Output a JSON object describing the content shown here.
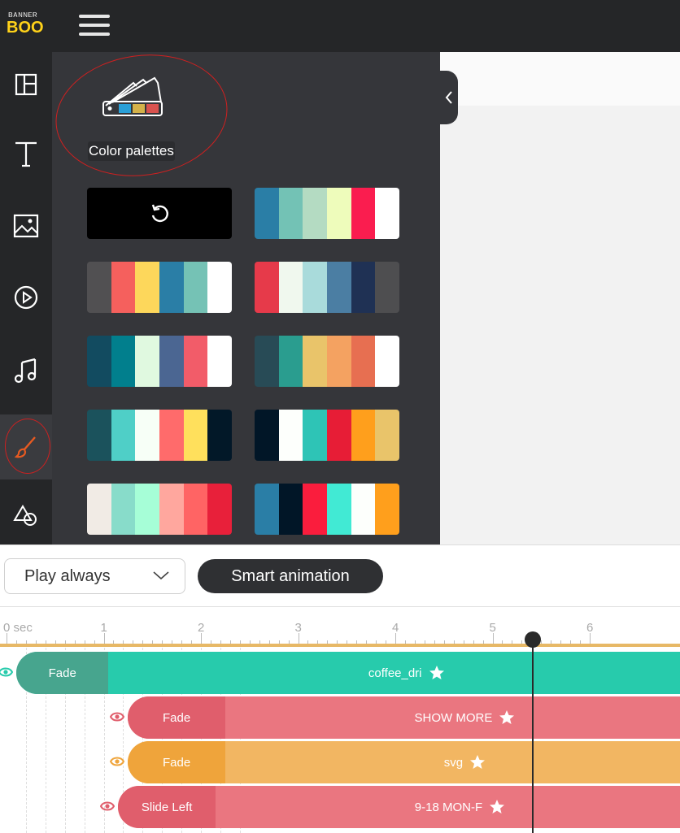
{
  "app": {
    "logo_top": "BANNER",
    "logo_bottom": "BOO"
  },
  "sidebar": {
    "items": [
      {
        "id": "layout",
        "icon": "layout-icon"
      },
      {
        "id": "text",
        "icon": "text-icon"
      },
      {
        "id": "image",
        "icon": "image-icon"
      },
      {
        "id": "video",
        "icon": "play-circle-icon"
      },
      {
        "id": "audio",
        "icon": "music-icon"
      },
      {
        "id": "colors",
        "icon": "brush-icon",
        "active": true
      },
      {
        "id": "shapes",
        "icon": "shapes-icon"
      }
    ]
  },
  "panel": {
    "title": "Color palettes",
    "palettes": [
      {
        "reset": true,
        "colors": []
      },
      {
        "colors": [
          "#2a7ea6",
          "#73c2b5",
          "#b4dbc2",
          "#eefcbb",
          "#fa1d4f",
          "#ffffff"
        ]
      },
      {
        "colors": [
          "#515052",
          "#f5605d",
          "#fdd75b",
          "#2a7ea6",
          "#75c2b5",
          "#ffffff"
        ]
      },
      {
        "colors": [
          "#e63a4a",
          "#f0f8ee",
          "#a9dbdb",
          "#4b7ea3",
          "#1f3154",
          "#4e4e50"
        ]
      },
      {
        "colors": [
          "#124b60",
          "#017f8d",
          "#e0f9e0",
          "#4b6692",
          "#f25c69",
          "#ffffff"
        ]
      },
      {
        "colors": [
          "#284b56",
          "#2a9d8f",
          "#e9c46a",
          "#f4a261",
          "#e76f51",
          "#ffffff"
        ]
      },
      {
        "colors": [
          "#1b525c",
          "#4fcfc7",
          "#f7fff7",
          "#ff6b6b",
          "#ffe05c",
          "#021828"
        ]
      },
      {
        "colors": [
          "#011627",
          "#fdfffc",
          "#2ec4b6",
          "#e71d36",
          "#ff9f1c",
          "#e9c46a"
        ]
      },
      {
        "colors": [
          "#f1ebe5",
          "#88dcca",
          "#a6fed7",
          "#ffa79e",
          "#ff6464",
          "#e8203a"
        ]
      },
      {
        "colors": [
          "#2a7ea6",
          "#011627",
          "#fa1d3d",
          "#41ead4",
          "#fdfffc",
          "#ff9f1c"
        ]
      }
    ]
  },
  "controls": {
    "play_mode": "Play always",
    "smart_animation": "Smart animation"
  },
  "timeline": {
    "ticks": [
      "0 sec",
      "1",
      "2",
      "3",
      "4",
      "5",
      "6"
    ],
    "playhead_sec": 5.42,
    "tracks": [
      {
        "animation": "Fade",
        "name": "coffee_dri",
        "start_sec": 0.1,
        "anim_end_sec": 1.05,
        "color": "#27cbac",
        "anim_color": "#47a58e",
        "eye_color": "#27cbac"
      },
      {
        "animation": "Fade",
        "name": "SHOW MORE",
        "start_sec": 1.25,
        "anim_end_sec": 2.25,
        "color": "#ea7680",
        "anim_color": "#e05e6c",
        "eye_color": "#e05e6c"
      },
      {
        "animation": "Fade",
        "name": "svg",
        "start_sec": 1.25,
        "anim_end_sec": 2.25,
        "color": "#f2b662",
        "anim_color": "#efa43b",
        "eye_color": "#efa43b"
      },
      {
        "animation": "Slide Left",
        "name": "9-18 MON-F",
        "start_sec": 1.15,
        "anim_end_sec": 2.15,
        "color": "#ea7680",
        "anim_color": "#e05e6c",
        "eye_color": "#e05e6c"
      }
    ]
  }
}
